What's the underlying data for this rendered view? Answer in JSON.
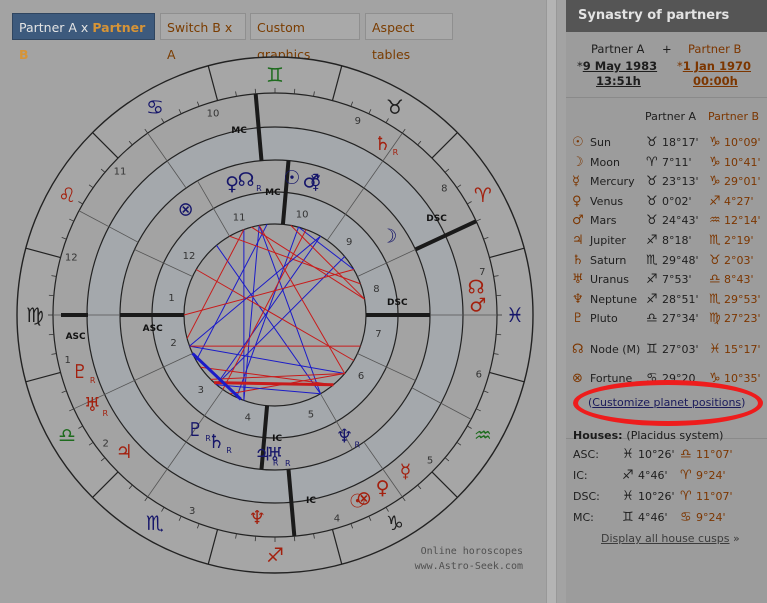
{
  "tabs": [
    {
      "label_a": "Partner A x ",
      "label_b": "Partner B",
      "active": true
    },
    {
      "label": "Switch B x A"
    },
    {
      "label": "Custom graphics"
    },
    {
      "label": "Aspect tables"
    }
  ],
  "credit": {
    "line1": "Online horoscopes",
    "line2": "www.Astro-Seek.com"
  },
  "panel": {
    "title": "Synastry of partners",
    "partner_a": {
      "label": "Partner A",
      "date": "9 May 1983",
      "time": "13:51h",
      "marker": "*"
    },
    "plus": "+",
    "partner_b": {
      "label": "Partner B",
      "date": "1 Jan 1970",
      "time": "00:00h",
      "marker": "*"
    },
    "col_a": "Partner A",
    "col_b": "Partner B",
    "planets": [
      {
        "icon": "sun-icon",
        "glyph": "☉",
        "name": "Sun",
        "sign_a": "♉",
        "pos_a": "18°17'",
        "sign_b": "♑",
        "pos_b": "10°09'"
      },
      {
        "icon": "moon-icon",
        "glyph": "☽",
        "name": "Moon",
        "sign_a": "♈",
        "pos_a": "7°11'",
        "sign_b": "♑",
        "pos_b": "10°41'"
      },
      {
        "icon": "mercury-icon",
        "glyph": "☿",
        "name": "Mercury",
        "sign_a": "♉",
        "pos_a": "23°13'",
        "sign_b": "♑",
        "pos_b": "29°01'"
      },
      {
        "icon": "venus-icon",
        "glyph": "♀",
        "name": "Venus",
        "sign_a": "♉",
        "pos_a": "0°02'",
        "sign_b": "♐",
        "pos_b": "4°27'"
      },
      {
        "icon": "mars-icon",
        "glyph": "♂",
        "name": "Mars",
        "sign_a": "♉",
        "pos_a": "24°43'",
        "sign_b": "♒",
        "pos_b": "12°14'"
      },
      {
        "icon": "jupiter-icon",
        "glyph": "♃",
        "name": "Jupiter",
        "sign_a": "♐",
        "pos_a": "8°18'",
        "sign_b": "♏",
        "pos_b": "2°19'"
      },
      {
        "icon": "saturn-icon",
        "glyph": "♄",
        "name": "Saturn",
        "sign_a": "♏",
        "pos_a": "29°48'",
        "sign_b": "♉",
        "pos_b": "2°03'"
      },
      {
        "icon": "uranus-icon",
        "glyph": "♅",
        "name": "Uranus",
        "sign_a": "♐",
        "pos_a": "7°53'",
        "sign_b": "♎",
        "pos_b": "8°43'"
      },
      {
        "icon": "neptune-icon",
        "glyph": "♆",
        "name": "Neptune",
        "sign_a": "♐",
        "pos_a": "28°51'",
        "sign_b": "♏",
        "pos_b": "29°53'"
      },
      {
        "icon": "pluto-icon",
        "glyph": "♇",
        "name": "Pluto",
        "sign_a": "♎",
        "pos_a": "27°34'",
        "sign_b": "♍",
        "pos_b": "27°23'"
      }
    ],
    "node": {
      "icon": "node-icon",
      "glyph": "☊",
      "name": "Node (M)",
      "sign_a": "♊",
      "pos_a": "27°03'",
      "sign_b": "♓",
      "pos_b": "15°17'"
    },
    "fortune": {
      "icon": "fortune-icon",
      "glyph": "⊗",
      "name": "Fortune",
      "sign_a": "♋",
      "pos_a": "29°20",
      "sign_b": "♑",
      "pos_b": "10°35'"
    },
    "customize": {
      "pre": "(",
      "link": "Customize planet positions",
      "post": ")"
    },
    "houses_title": "Houses:",
    "houses_system": "(Placidus system)",
    "houses": [
      {
        "name": "ASC:",
        "sign_a": "♓",
        "pos_a": "10°26'",
        "sign_b": "♎",
        "pos_b": "11°07'"
      },
      {
        "name": "IC:",
        "sign_a": "♐",
        "pos_a": "4°46'",
        "sign_b": "♈",
        "pos_b": "9°24'"
      },
      {
        "name": "DSC:",
        "sign_a": "♓",
        "pos_a": "10°26'",
        "sign_b": "♈",
        "pos_b": "11°07'"
      },
      {
        "name": "MC:",
        "sign_a": "♊",
        "pos_a": "4°46'",
        "sign_b": "♋",
        "pos_b": "9°24'"
      }
    ],
    "display_cusps": "Display all house cusps",
    "arrow": "»"
  },
  "wheel": {
    "zodiac": [
      {
        "glyph": "♓",
        "color": "#16166a"
      },
      {
        "glyph": "♈",
        "color": "#a3200e"
      },
      {
        "glyph": "♉",
        "color": "#1e1e1e"
      },
      {
        "glyph": "♊",
        "color": "#1d6b1d"
      },
      {
        "glyph": "♋",
        "color": "#16166a"
      },
      {
        "glyph": "♌",
        "color": "#a3200e"
      },
      {
        "glyph": "♍",
        "color": "#1e1e1e"
      },
      {
        "glyph": "♎",
        "color": "#1d6b1d"
      },
      {
        "glyph": "♏",
        "color": "#16166a"
      },
      {
        "glyph": "♐",
        "color": "#a3200e"
      },
      {
        "glyph": "♑",
        "color": "#1e1e1e"
      },
      {
        "glyph": "♒",
        "color": "#1d6b1d"
      }
    ],
    "outer_house_numbers": [
      "7",
      "8",
      "9",
      "10",
      "11",
      "12",
      "1",
      "2",
      "3",
      "4",
      "5",
      "6"
    ],
    "inner_house_numbers": [
      "1",
      "2",
      "3",
      "4",
      "5",
      "6",
      "7",
      "8",
      "9",
      "10",
      "11",
      "12"
    ],
    "outer_angles": {
      "asc": "ASC",
      "dsc": "DSC",
      "mc": "MC",
      "ic": "IC"
    },
    "inner_angles": {
      "asc": "ASC",
      "dsc": "DSC",
      "mc": "MC",
      "ic": "IC"
    },
    "planets_a": [
      {
        "glyph": "☊",
        "color": "#16166a",
        "retro": "R"
      },
      {
        "glyph": "♀",
        "color": "#16166a",
        "retro": ""
      },
      {
        "glyph": "☉",
        "color": "#16166a",
        "retro": ""
      },
      {
        "glyph": "☿",
        "color": "#16166a",
        "retro": ""
      },
      {
        "glyph": "♂",
        "color": "#16166a",
        "retro": ""
      },
      {
        "glyph": "⊗",
        "color": "#16166a",
        "retro": ""
      },
      {
        "glyph": "☽",
        "color": "#16166a",
        "retro": ""
      },
      {
        "glyph": "♇",
        "color": "#16166a",
        "retro": "R"
      },
      {
        "glyph": "♄",
        "color": "#16166a",
        "retro": "R"
      },
      {
        "glyph": "♃",
        "color": "#16166a",
        "retro": "R"
      },
      {
        "glyph": "♅",
        "color": "#16166a",
        "retro": "R"
      },
      {
        "glyph": "♆",
        "color": "#16166a",
        "retro": "R"
      }
    ],
    "planets_b": [
      {
        "glyph": "♄",
        "color": "#a3200e",
        "retro": "R"
      },
      {
        "glyph": "☊",
        "color": "#a3200e",
        "retro": ""
      },
      {
        "glyph": "♂",
        "color": "#a3200e",
        "retro": ""
      },
      {
        "glyph": "♀",
        "color": "#a3200e",
        "retro": ""
      },
      {
        "glyph": "⊗",
        "color": "#a3200e",
        "retro": ""
      },
      {
        "glyph": "☉",
        "color": "#a3200e",
        "retro": ""
      },
      {
        "glyph": "☿",
        "color": "#a3200e",
        "retro": ""
      },
      {
        "glyph": "♆",
        "color": "#a3200e",
        "retro": ""
      },
      {
        "glyph": "♃",
        "color": "#a3200e",
        "retro": ""
      },
      {
        "glyph": "♅",
        "color": "#a3200e",
        "retro": "R"
      },
      {
        "glyph": "♇",
        "color": "#a3200e",
        "retro": "R"
      }
    ],
    "aspect_colors": {
      "harmonic": "#1b1bc8",
      "tense": "#c81b1b"
    }
  }
}
